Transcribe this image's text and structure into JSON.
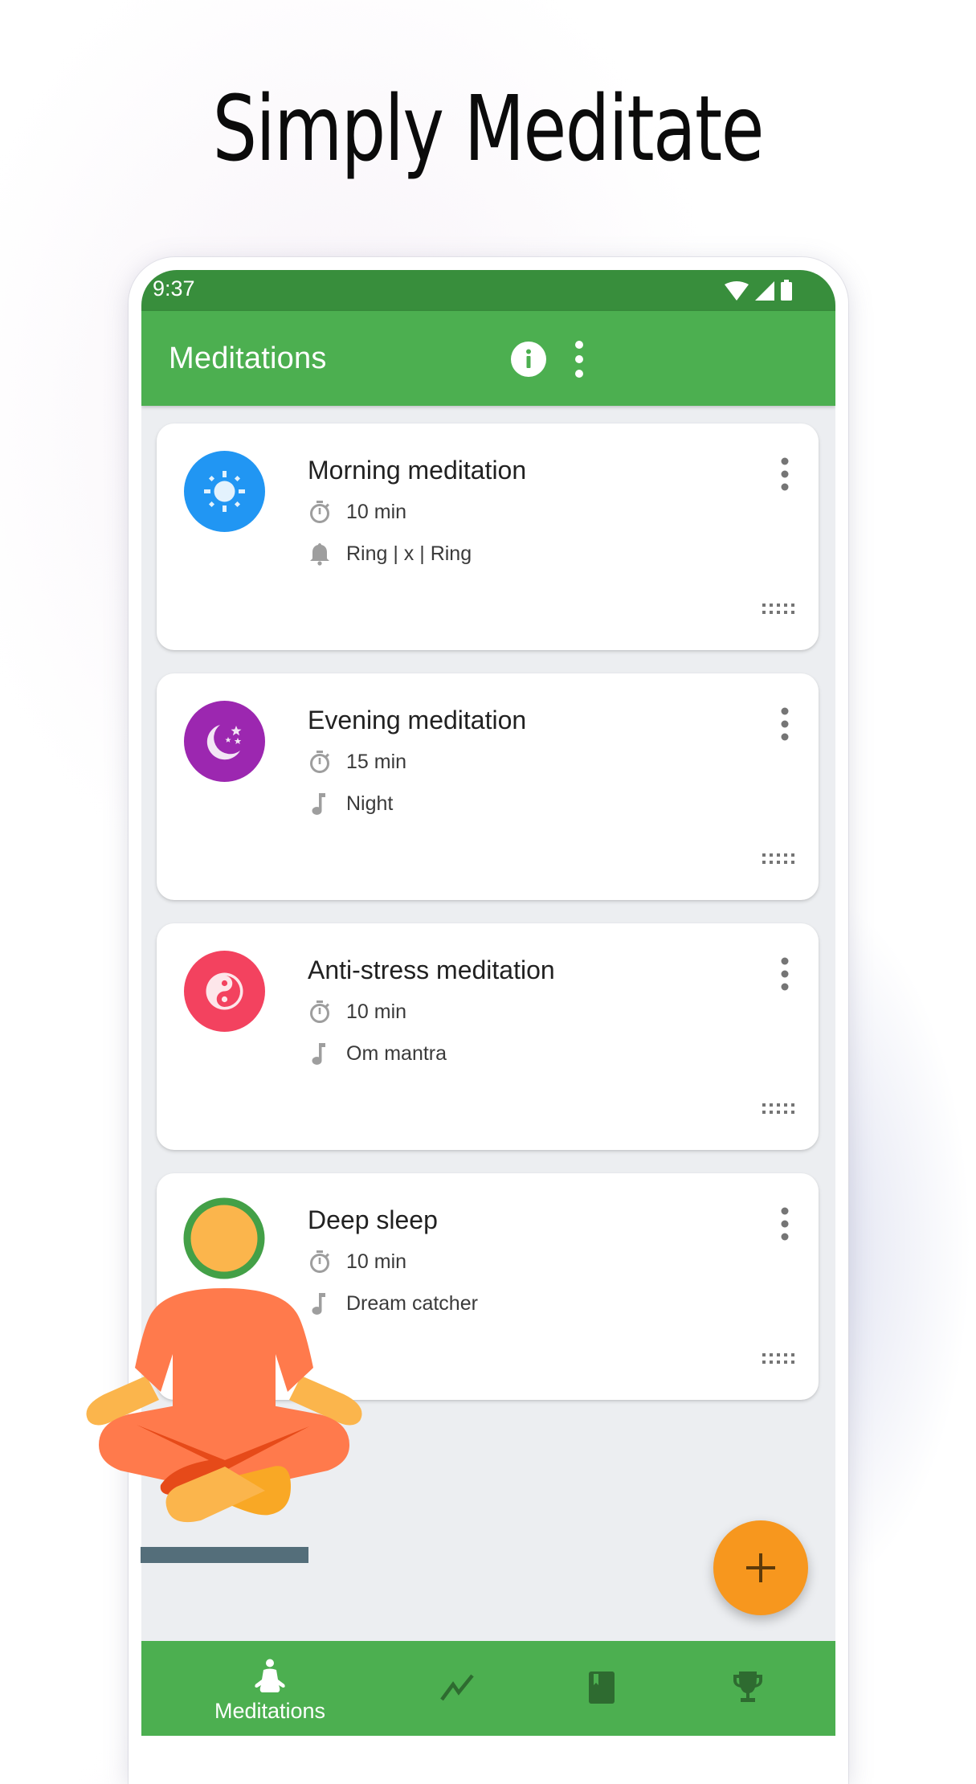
{
  "headline": "Simply Meditate",
  "status_bar": {
    "time": "9:37",
    "icons": [
      "wifi-icon",
      "signal-icon",
      "battery-icon"
    ]
  },
  "app_bar": {
    "title": "Meditations",
    "actions": [
      "info-icon",
      "more-vert-icon"
    ]
  },
  "meditations": [
    {
      "title": "Morning meditation",
      "duration": "10 min",
      "sound_icon": "bell-icon",
      "sound": "Ring | x | Ring",
      "avatar_icon": "sun-icon",
      "avatar_color": "#2196f3"
    },
    {
      "title": "Evening meditation",
      "duration": "15 min",
      "sound_icon": "music-note-icon",
      "sound": "Night",
      "avatar_icon": "moon-stars-icon",
      "avatar_color": "#9c27b0"
    },
    {
      "title": "Anti-stress meditation",
      "duration": "10 min",
      "sound_icon": "music-note-icon",
      "sound": "Om mantra",
      "avatar_icon": "yin-yang-icon",
      "avatar_color": "#f3425f"
    },
    {
      "title": "Deep sleep",
      "duration": "10 min",
      "sound_icon": "music-note-icon",
      "sound": "Dream catcher",
      "avatar_icon": "",
      "avatar_color": ""
    }
  ],
  "fab": {
    "icon": "plus-icon",
    "color": "#f7971e"
  },
  "bottom_nav": {
    "items": [
      {
        "icon": "meditation-pose-icon",
        "label": "Meditations",
        "active": true
      },
      {
        "icon": "trend-chart-icon",
        "label": "",
        "active": false
      },
      {
        "icon": "book-bookmark-icon",
        "label": "",
        "active": false
      },
      {
        "icon": "trophy-icon",
        "label": "",
        "active": false
      }
    ]
  },
  "colors": {
    "primary": "#4caf50",
    "primary_dark": "#388e3c",
    "accent": "#f7971e",
    "inactive_nav_icon": "#2e6b30",
    "meta_icon": "#9e9e9e"
  }
}
